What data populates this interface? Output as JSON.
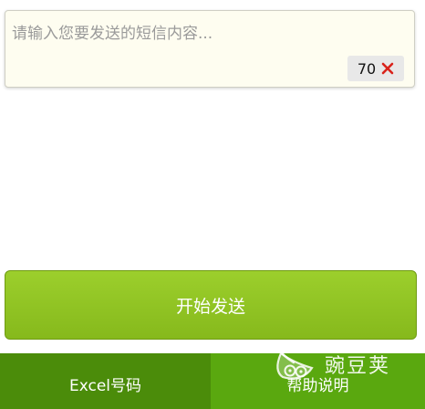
{
  "composer": {
    "placeholder": "请输入您要发送的短信内容...",
    "char_count": "70"
  },
  "send_button": {
    "label": "开始发送"
  },
  "tabs": [
    {
      "label": "Excel号码"
    },
    {
      "label": "帮助说明"
    }
  ],
  "watermark": {
    "text": "豌豆荚"
  },
  "colors": {
    "send_button": "#8fc424",
    "tab_excel_bg": "#4b8c0a",
    "tab_help_bg": "#5aa80f",
    "composer_bg": "#fefdf0",
    "clear_icon": "#d9231b"
  },
  "icons": {
    "clear": "close-icon",
    "watermark_logo": "pea-pod-logo"
  }
}
